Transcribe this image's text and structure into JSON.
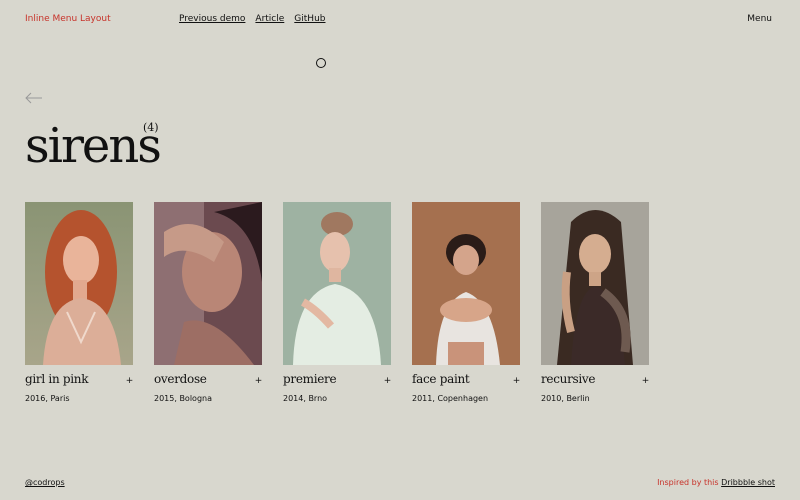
{
  "header": {
    "title": "Inline Menu Layout",
    "links": [
      "Previous demo",
      "Article",
      "GitHub"
    ],
    "menu_label": "Menu"
  },
  "page": {
    "title": "sirens",
    "count": "(4)"
  },
  "cards": [
    {
      "title": "girl in pink",
      "meta": "2016, Paris",
      "action": "+"
    },
    {
      "title": "overdose",
      "meta": "2015, Bologna",
      "action": "+"
    },
    {
      "title": "premiere",
      "meta": "2014, Brno",
      "action": "+"
    },
    {
      "title": "face paint",
      "meta": "2011, Copenhagen",
      "action": "+"
    },
    {
      "title": "recursive",
      "meta": "2010, Berlin",
      "action": "+"
    }
  ],
  "footer": {
    "credit": "@codrops",
    "inspired_text": "Inspired by this",
    "inspired_link": "Dribbble shot"
  },
  "colors": {
    "background": "#d8d7ce",
    "accent": "#c7332a"
  }
}
